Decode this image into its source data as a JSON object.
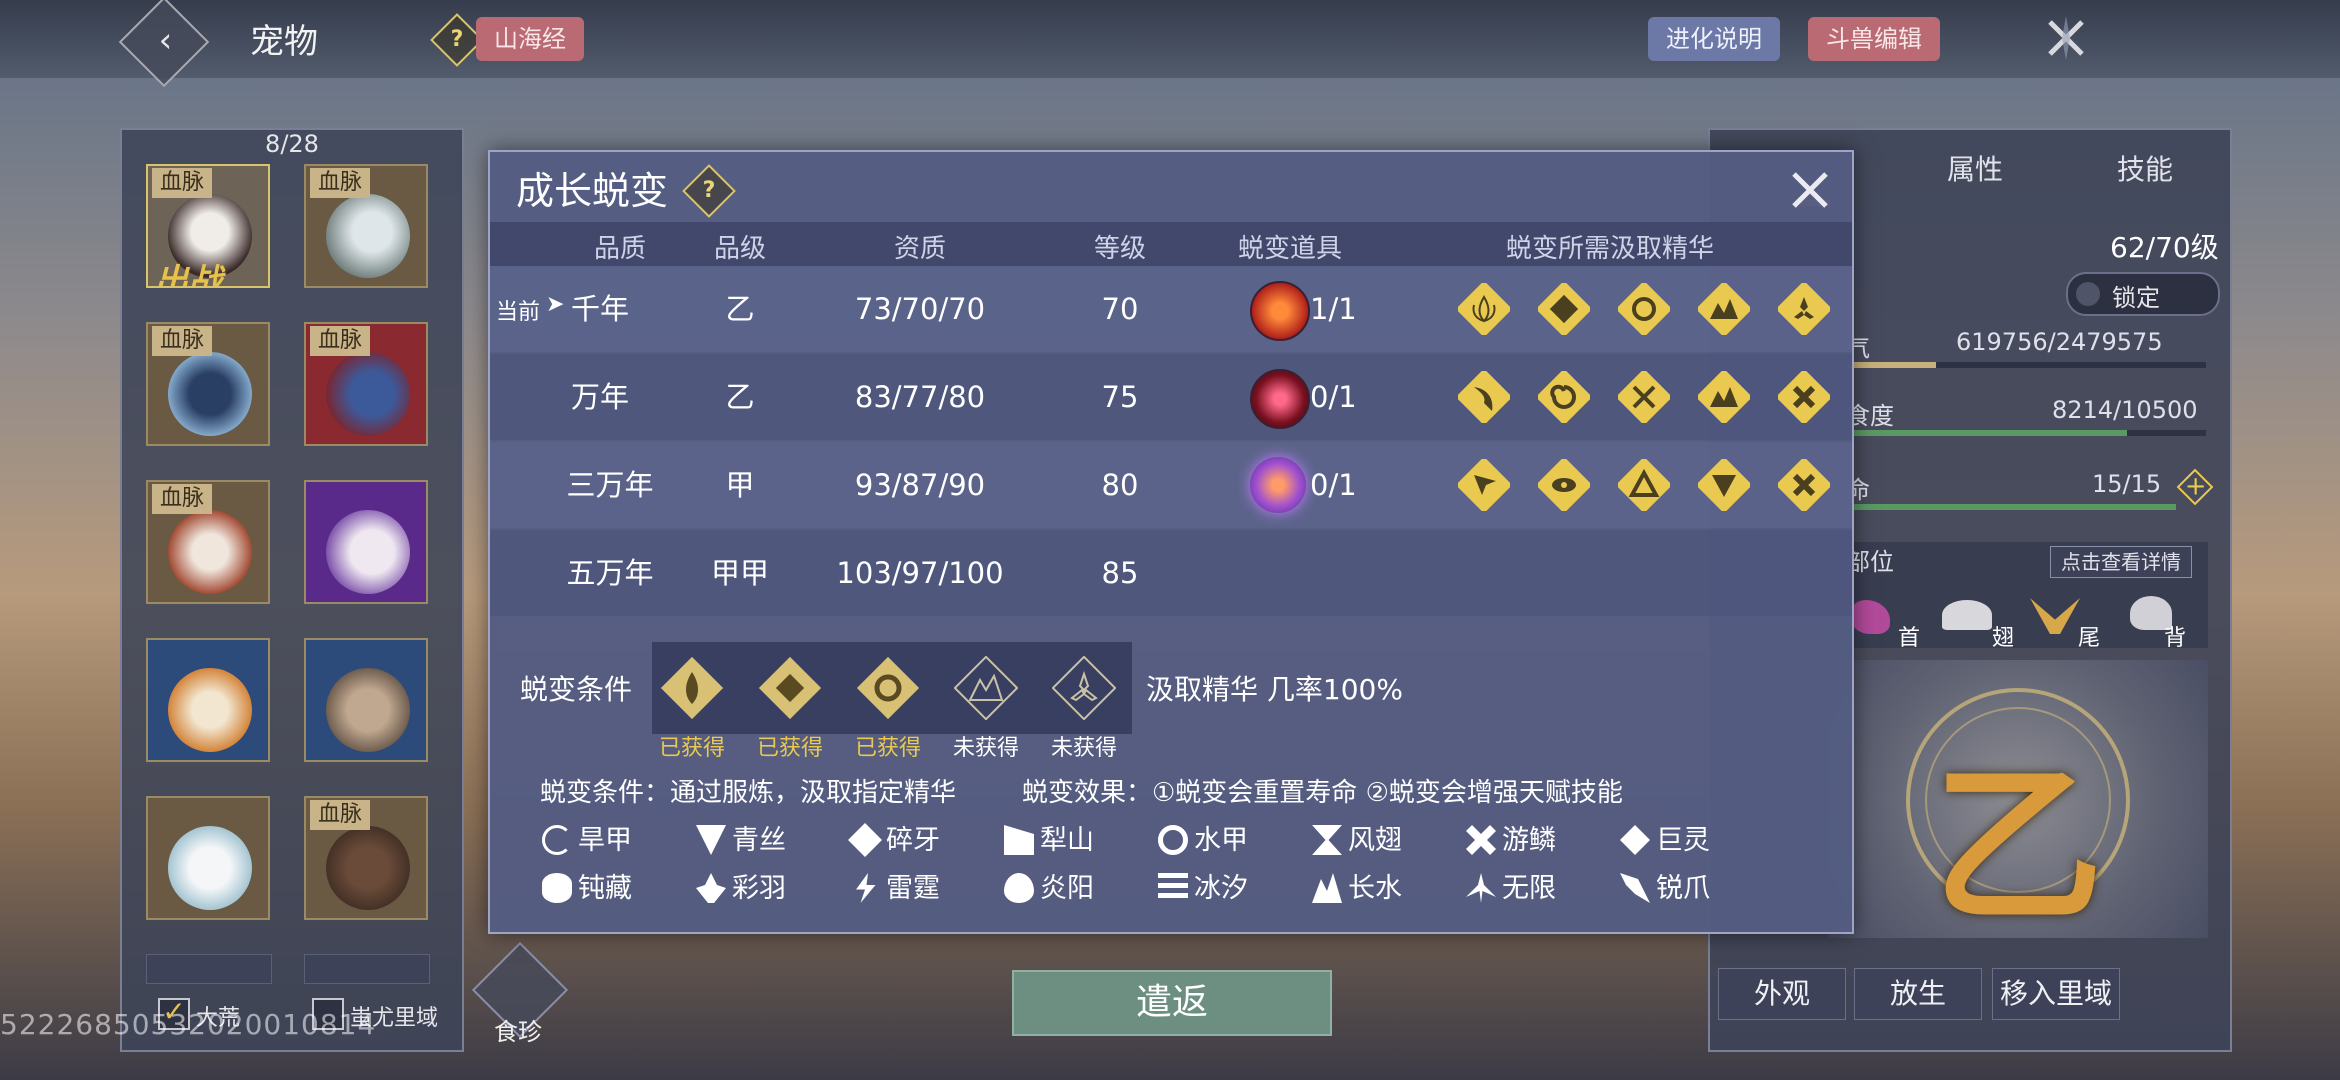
{
  "header": {
    "title": "宠物",
    "shanhai_label": "山海经",
    "evolution_info_label": "进化说明",
    "beast_edit_label": "斗兽编辑"
  },
  "left": {
    "count": "8/28",
    "blood_tag": "血脉",
    "deployed": "出战",
    "filter_dahuang": "大荒",
    "filter_chiyou": "蚩尤里域"
  },
  "right": {
    "tabs": [
      "属性",
      "技能"
    ],
    "level": "62/70级",
    "lock_label": "锁定",
    "stat1_label": "气",
    "stat1_value": "619756/2479575",
    "stat1_ratio": 0.25,
    "stat2_label": "食度",
    "stat2_value": "8214/10500",
    "stat2_ratio": 0.78,
    "stat3_label": "命",
    "stat3_value": "15/15",
    "stat3_ratio": 1.0,
    "parts_label": "部位",
    "view_details": "点击查看详情",
    "parts": [
      "首",
      "翅",
      "尾",
      "背"
    ],
    "grade_char": "乙",
    "btn_appearance": "外观",
    "btn_release": "放生",
    "btn_move": "移入里域"
  },
  "modal": {
    "title": "成长蜕变",
    "headers": [
      "品质",
      "品级",
      "资质",
      "等级",
      "蜕变道具",
      "蜕变所需汲取精华"
    ],
    "current_label": "当前",
    "rows": [
      {
        "quality": "千年",
        "grade": "乙",
        "aptitude": "73/70/70",
        "level": "70",
        "item": "1/1"
      },
      {
        "quality": "万年",
        "grade": "乙",
        "aptitude": "83/77/80",
        "level": "75",
        "item": "0/1"
      },
      {
        "quality": "三万年",
        "grade": "甲",
        "aptitude": "93/87/90",
        "level": "80",
        "item": "0/1"
      },
      {
        "quality": "五万年",
        "grade": "甲甲",
        "aptitude": "103/97/100",
        "level": "85",
        "item": ""
      }
    ],
    "condition_label": "蜕变条件",
    "essence_status": [
      "已获得",
      "已获得",
      "已获得",
      "未获得",
      "未获得"
    ],
    "rate_text": "汲取精华 几率100%",
    "desc_condition": "蜕变条件：通过服炼，汲取指定精华",
    "desc_effect": "蜕变效果：①蜕变会重置寿命 ②蜕变会增强天赋技能",
    "legend": [
      "旱甲",
      "青丝",
      "碎牙",
      "犁山",
      "水甲",
      "风翅",
      "游鳞",
      "巨灵",
      "钝藏",
      "彩羽",
      "雷霆",
      "炎阳",
      "冰汐",
      "长水",
      "无限",
      "锐爪"
    ]
  },
  "bottom": {
    "return_label": "遣返",
    "food_label": "食珍",
    "watermark": "52226850532020010814"
  },
  "colors": {
    "gold": "#e9c94f",
    "obtained": "#e9c94f",
    "not_obtained": "#ffffff",
    "modal_bg": "#545c82"
  }
}
